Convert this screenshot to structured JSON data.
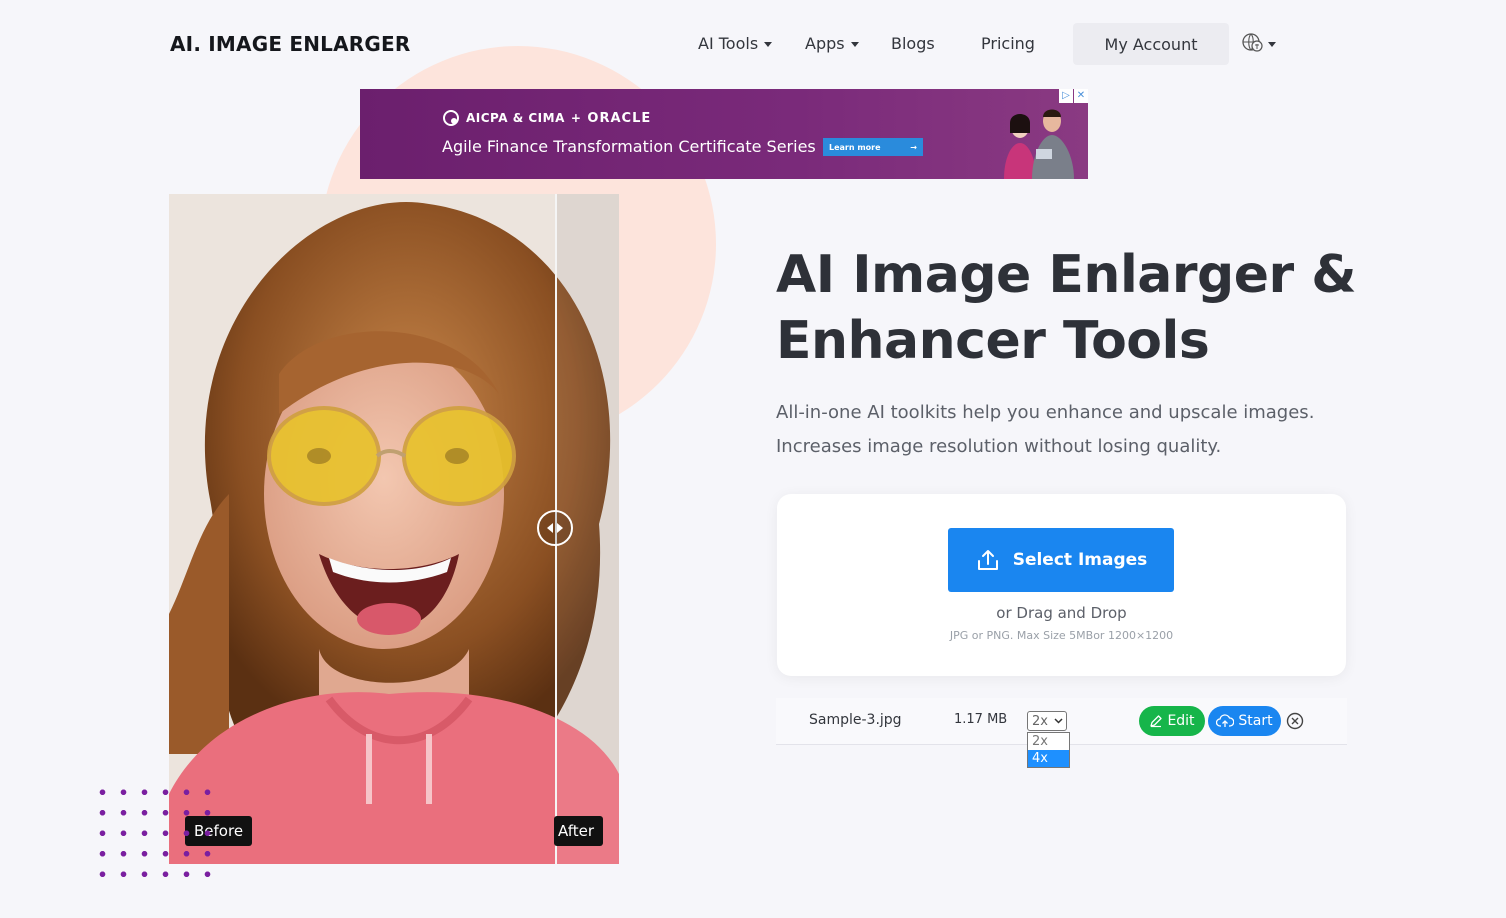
{
  "header": {
    "logo": "AI. IMAGE ENLARGER",
    "nav": [
      {
        "label": "AI Tools"
      },
      {
        "label": "Apps"
      },
      {
        "label": "Blogs"
      },
      {
        "label": "Pricing"
      }
    ],
    "account_label": "My Account"
  },
  "ad": {
    "brand_left": "AICPA & CIMA",
    "brand_sep": "+",
    "brand_right": "ORACLE",
    "title": "Agile Finance Transformation Certificate Series",
    "cta": "Learn more"
  },
  "compare": {
    "before_label": "Before",
    "after_label": "After"
  },
  "hero": {
    "title_line1": "AI Image Enlarger &",
    "title_line2": "Enhancer Tools",
    "sub_line1": "All-in-one AI toolkits help you enhance and upscale images.",
    "sub_line2": "Increases image resolution without losing quality."
  },
  "upload": {
    "button_label": "Select Images",
    "drag_text": "or Drag and Drop",
    "limits_text": "JPG or PNG. Max Size 5MBor 1200×1200"
  },
  "file": {
    "name": "Sample-3.jpg",
    "size": "1.17 MB",
    "scale_selected": "2x",
    "scale_options": [
      "2x",
      "4x"
    ],
    "highlighted_option": "4x",
    "edit_label": "Edit",
    "start_label": "Start"
  },
  "colors": {
    "primary": "#1a86f0",
    "success": "#16b54a",
    "blob": "#fde4dc",
    "ad_bg": "#6b1f6d",
    "dots": "#7a1fa0"
  }
}
